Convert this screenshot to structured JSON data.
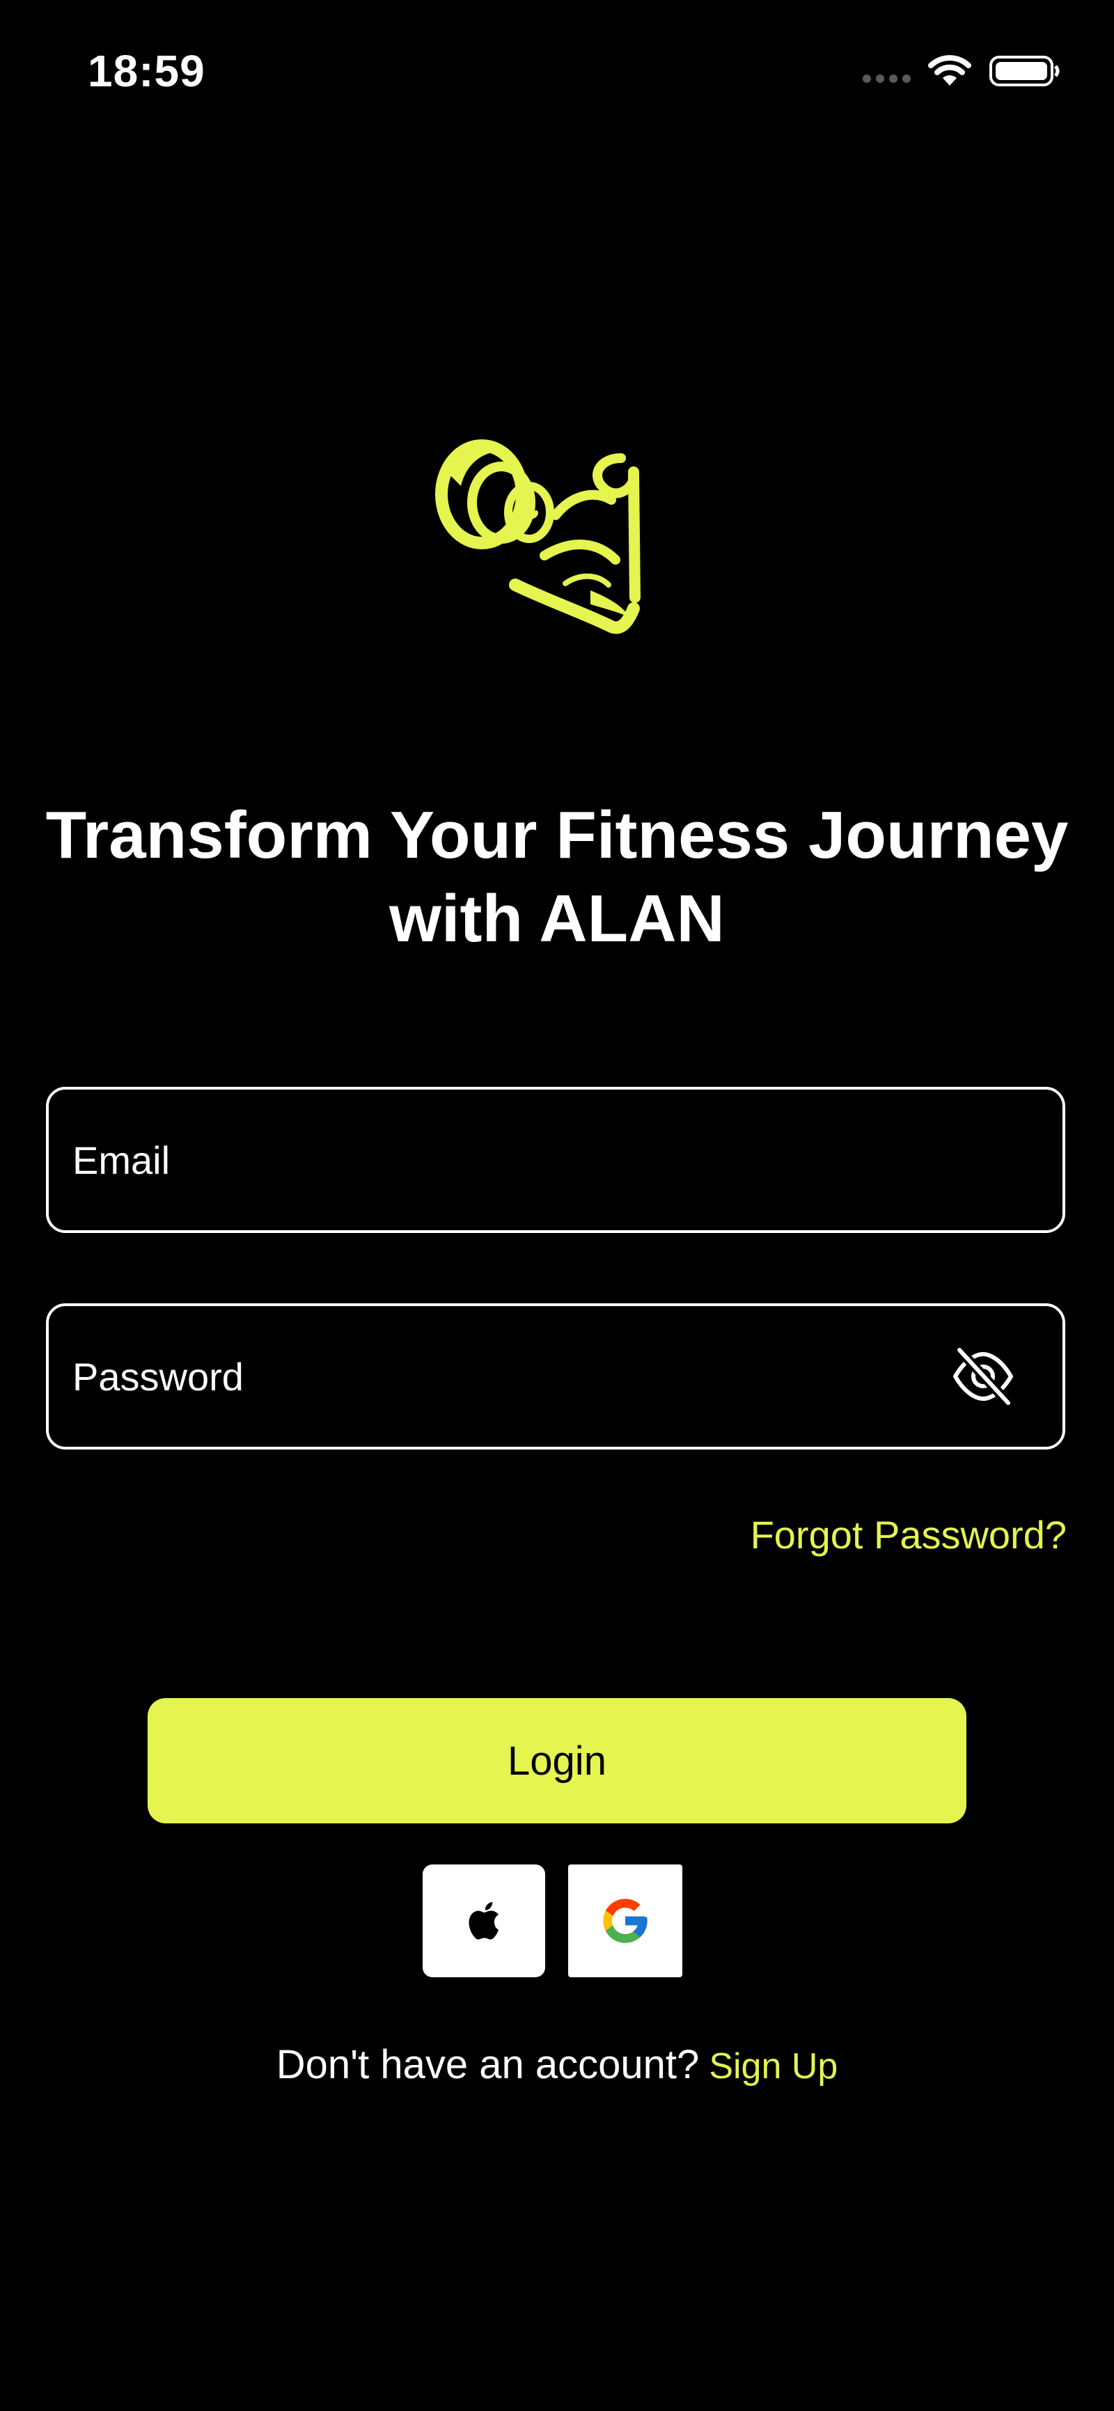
{
  "status_bar": {
    "time": "18:59"
  },
  "brand": {
    "logo_icon": "flexing-arm-dumbbell-logo",
    "accent_color": "#e5f44e"
  },
  "headline": {
    "line1": "Transform Your Fitness Journey",
    "line2": "with ALAN"
  },
  "form": {
    "email_placeholder": "Email",
    "password_placeholder": "Password",
    "password_toggle_icon": "eye-slash-icon",
    "forgot_password_label": "Forgot Password?",
    "login_label": "Login"
  },
  "social": {
    "apple_icon": "apple-icon",
    "google_icon": "google-icon"
  },
  "signup": {
    "prompt": "Don't have an account?",
    "link_label": "Sign Up"
  }
}
